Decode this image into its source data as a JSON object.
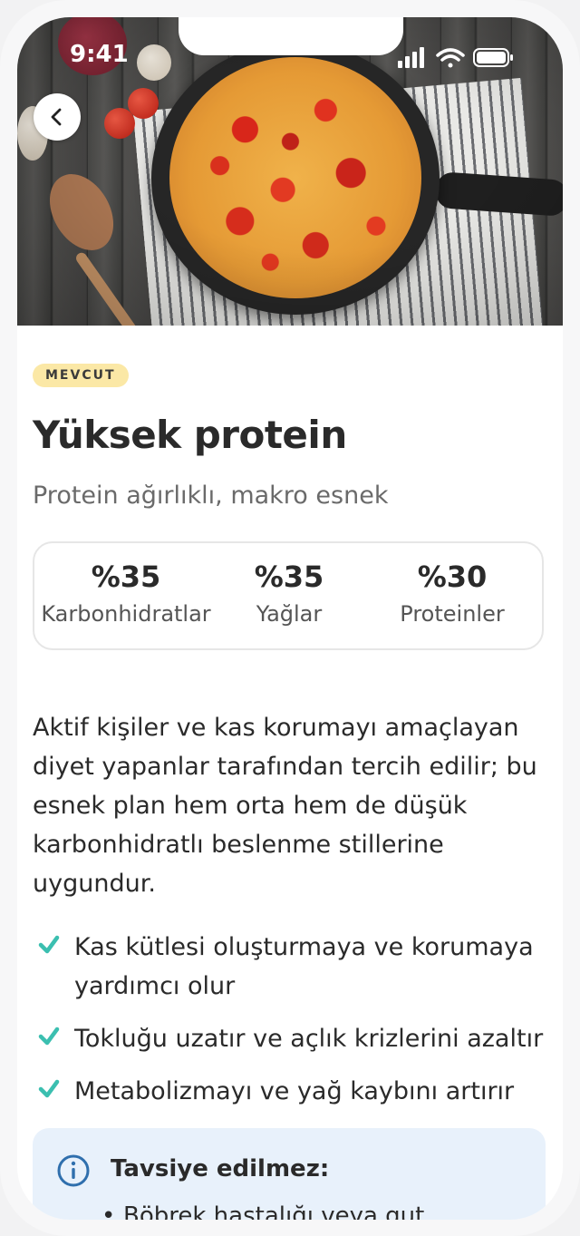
{
  "status_bar": {
    "time": "9:41"
  },
  "hero": {
    "alt": "Omelette with tomatoes in a pan"
  },
  "plan": {
    "badge": "MEVCUT",
    "title": "Yüksek protein",
    "subtitle": "Protein ağırlıklı, makro esnek",
    "macros": [
      {
        "value": "%35",
        "label": "Karbonhidratlar"
      },
      {
        "value": "%35",
        "label": "Yağlar"
      },
      {
        "value": "%30",
        "label": "Proteinler"
      }
    ],
    "description": "Aktif kişiler ve kas korumayı amaçlayan diyet yapanlar tarafından tercih edilir; bu esnek plan hem orta hem de düşük karbonhidratlı beslenme stillerine uygundur.",
    "benefits": [
      "Kas kütlesi oluşturmaya ve korumaya yardımcı olur",
      "Tokluğu uzatır ve açlık krizlerini azaltır",
      "Metabolizmayı ve yağ kaybını artırır"
    ],
    "warning": {
      "title": "Tavsiye edilmez:",
      "items": [
        "Böbrek hastalığı veya gut"
      ]
    }
  },
  "colors": {
    "badge_bg": "#fbe8a6",
    "check": "#3bbfb0",
    "info_box_bg": "#e8f1fb",
    "info_icon": "#2f6fad"
  },
  "icons": {
    "back": "chevron-left-icon",
    "check": "check-icon",
    "info": "info-icon"
  }
}
